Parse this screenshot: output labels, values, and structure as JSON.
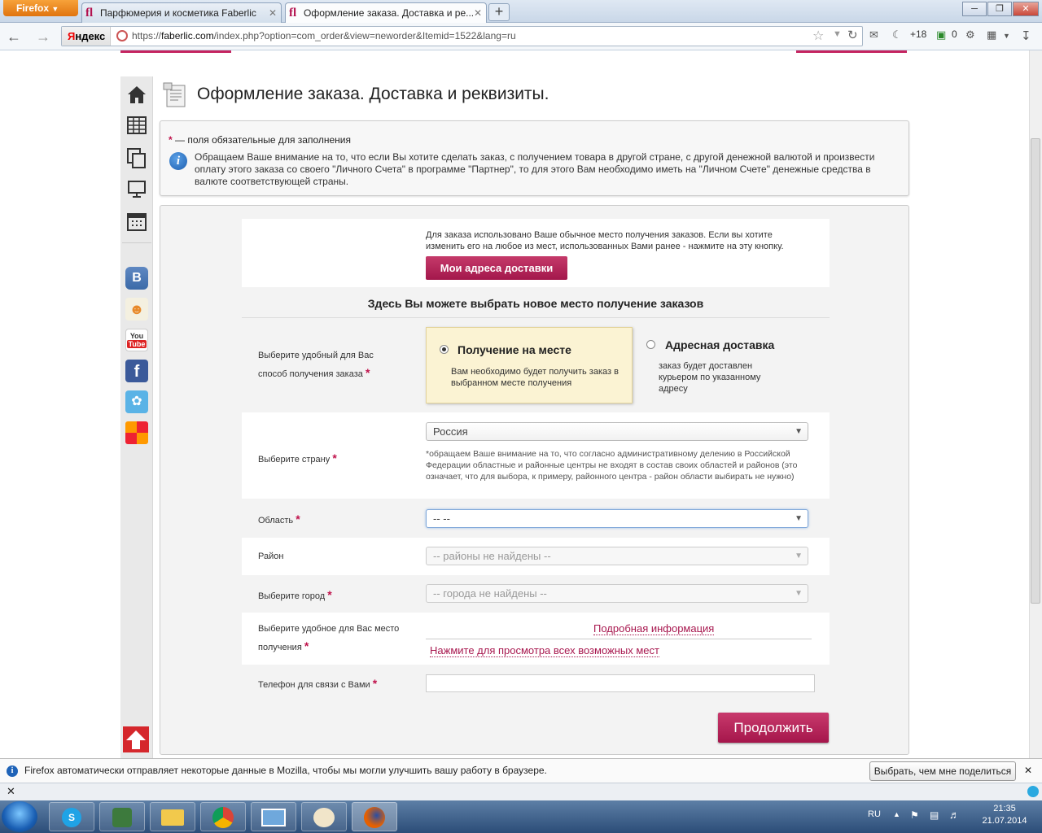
{
  "browser": {
    "menu_label": "Firefox",
    "tabs": [
      {
        "label": "Парфюмерия и косметика Faberlic",
        "icon": "fl"
      },
      {
        "label": "Оформление заказа. Доставка и ре...",
        "icon": "fl"
      }
    ],
    "new_tab": "+",
    "url_prefix": "https://",
    "url_host": "faberlic.com",
    "url_path": "/index.php?option=com_order&view=neworder&Itemid=1522&lang=ru",
    "search_engine": {
      "first": "Я",
      "rest": "ндекс"
    },
    "toolbar_counters": {
      "moon": "+18",
      "square": "0"
    }
  },
  "page": {
    "title": "Оформление заказа. Доставка и реквизиты.",
    "required_note": "— поля обязательные для заполнения",
    "required_star": "*",
    "info_icon": "i",
    "info_text": "Обращаем Ваше внимание на то, что если Вы хотите сделать заказ, с получением товара в другой стране, с другой денежной валютой и произвести оплату этого заказа со своего \"Личного Счета\" в программе \"Партнер\", то для этого Вам необходимо иметь на \"Личном Счете\" денежные средства в валюте соответствующей страны.",
    "saved_address_note": "Для заказа использовано Ваше обычное место получения заказов. Если вы хотите изменить его на любое из мест, использованных Вами ранее - нажмите на эту кнопку.",
    "my_addresses_button": "Мои адреса доставки",
    "choose_title": "Здесь Вы можете выбрать новое место получение заказов",
    "delivery": {
      "label": "Выберите удобный для Вас способ получения заказа",
      "pickup_title": "Получение на месте",
      "pickup_desc": "Вам необходимо будет получить заказ в выбранном месте получения",
      "pickup_selected": true,
      "courier_title": "Адресная доставка",
      "courier_desc": "заказ будет доставлен курьером по указанному адресу"
    },
    "country": {
      "label": "Выберите страну",
      "value": "Россия",
      "note": "*обращаем Ваше внимание на то, что согласно административному делению в Российской Федерации областные и районные центры не входят в состав своих областей и районов (это означает, что для выбора, к примеру, районного центра - район области выбирать не нужно)"
    },
    "region": {
      "label": "Область",
      "value": "-- --"
    },
    "district": {
      "label": "Район",
      "value": "-- районы не найдены --"
    },
    "city": {
      "label": "Выберите город",
      "value": "-- города не найдены --"
    },
    "pickup_point": {
      "label": "Выберите удобное для Вас место получения",
      "details_link": "Подробная информация",
      "all_places_link": "Нажмите для просмотра всех возможных мест"
    },
    "phone": {
      "label": "Телефон для связи с Вами",
      "value": ""
    },
    "continue_button": "Продолжить"
  },
  "notification": {
    "text": "Firefox автоматически отправляет некоторые данные в Mozilla, чтобы мы могли улучшить вашу работу в браузере.",
    "button": "Выбрать, чем мне поделиться",
    "close": "✕"
  },
  "taskbar": {
    "lang": "RU",
    "time": "21:35",
    "date": "21.07.2014"
  },
  "colors": {
    "brand": "#b3124f",
    "button": "#a5164b",
    "pickup_bg": "#fbf3d3"
  }
}
